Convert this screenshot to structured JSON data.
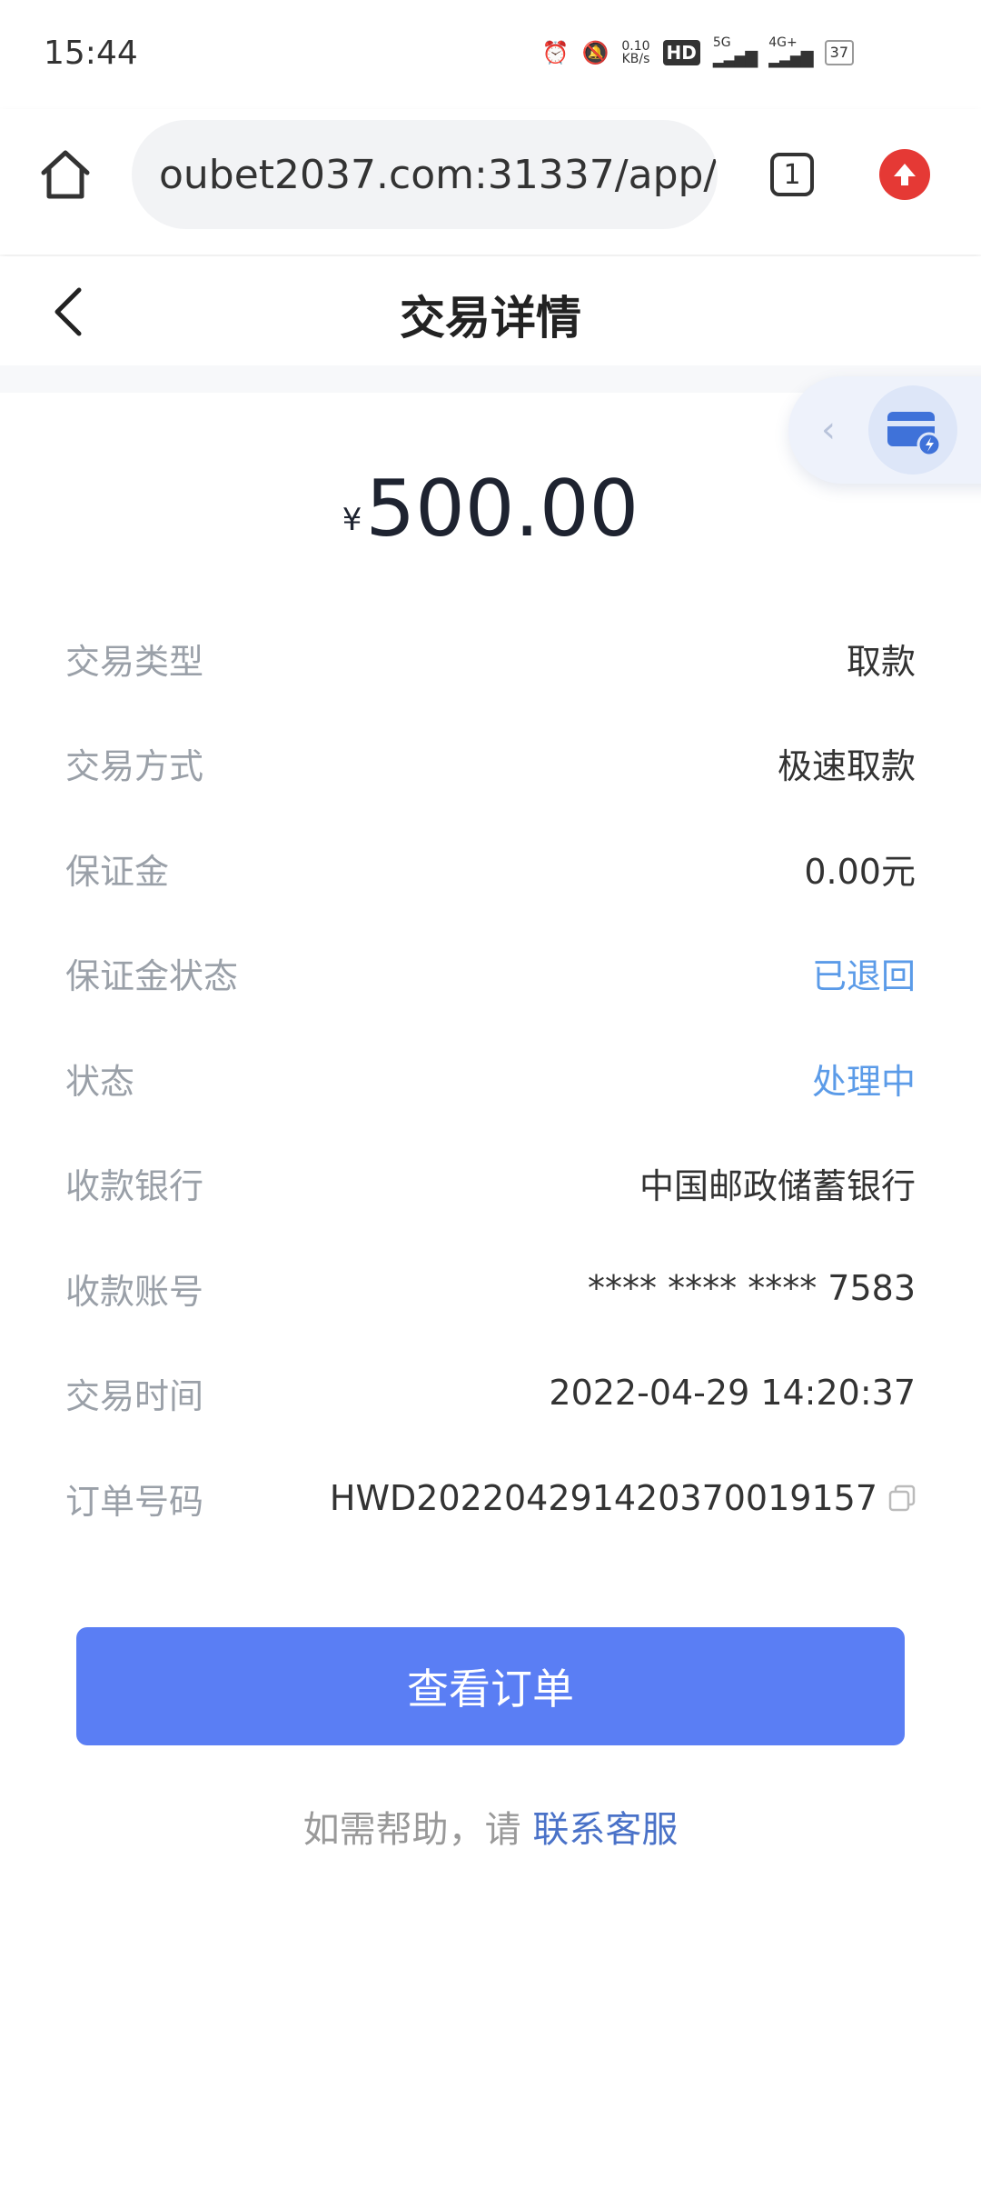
{
  "status_bar": {
    "time": "15:44",
    "net_speed_value": "0.10",
    "net_speed_unit": "KB/s",
    "hd_label": "HD",
    "sim_5g": "5G",
    "sim_4g": "4G+",
    "battery": "37"
  },
  "browser": {
    "url": "oubet2037.com:31337/app/",
    "tab_count": "1"
  },
  "header": {
    "title": "交易详情"
  },
  "amount": {
    "currency": "¥",
    "value": "500.00"
  },
  "details": [
    {
      "label": "交易类型",
      "value": "取款",
      "highlight": false
    },
    {
      "label": "交易方式",
      "value": "极速取款",
      "highlight": false
    },
    {
      "label": "保证金",
      "value": "0.00元",
      "highlight": false
    },
    {
      "label": "保证金状态",
      "value": "已退回",
      "highlight": true
    },
    {
      "label": "状态",
      "value": "处理中",
      "highlight": true
    },
    {
      "label": "收款银行",
      "value": "中国邮政储蓄银行",
      "highlight": false
    },
    {
      "label": "收款账号",
      "value": "**** **** **** 7583",
      "highlight": false
    },
    {
      "label": "交易时间",
      "value": "2022-04-29 14:20:37",
      "highlight": false
    },
    {
      "label": "订单号码",
      "value": "HWD20220429142037001915​7",
      "highlight": false
    }
  ],
  "actions": {
    "view_order_label": "查看订单"
  },
  "help": {
    "prefix": "如需帮助，请",
    "link": "联系客服"
  },
  "colors": {
    "accent_button": "#5a7ef4",
    "highlight_text": "#5b9be8",
    "link": "#4a72c8"
  },
  "icons": {
    "home": "home-icon",
    "back": "chevron-left-icon",
    "tabs": "tabs-icon",
    "update": "arrow-up-icon",
    "card": "card-icon",
    "copy": "copy-icon"
  }
}
